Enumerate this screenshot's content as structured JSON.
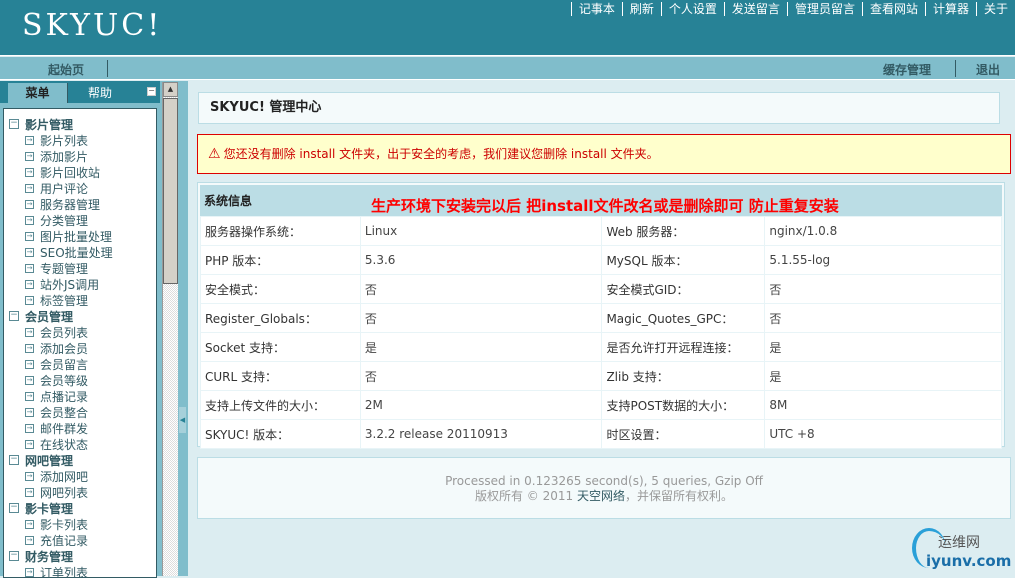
{
  "header": {
    "logo": "SKYUC!",
    "nav": [
      "记事本",
      "刷新",
      "个人设置",
      "发送留言",
      "管理员留言",
      "查看网站",
      "计算器",
      "关于"
    ]
  },
  "bar": {
    "home": "起始页",
    "cache": "缓存管理",
    "logout": "退出"
  },
  "sidebar": {
    "tabs": [
      "菜单",
      "帮助"
    ],
    "collapse": "−",
    "groups": [
      {
        "title": "影片管理",
        "items": [
          "影片列表",
          "添加影片",
          "影片回收站",
          "用户评论",
          "服务器管理",
          "分类管理",
          "图片批量处理",
          "SEO批量处理",
          "专题管理",
          "站外JS调用",
          "标签管理"
        ]
      },
      {
        "title": "会员管理",
        "items": [
          "会员列表",
          "添加会员",
          "会员留言",
          "会员等级",
          "点播记录",
          "会员整合",
          "邮件群发",
          "在线状态"
        ]
      },
      {
        "title": "网吧管理",
        "items": [
          "添加网吧",
          "网吧列表"
        ]
      },
      {
        "title": "影卡管理",
        "items": [
          "影卡列表",
          "充值记录"
        ]
      },
      {
        "title": "财务管理",
        "items": [
          "订单列表"
        ]
      }
    ]
  },
  "main": {
    "title": "SKYUC! 管理中心",
    "warning": "您还没有删除 install 文件夹，出于安全的考虑，我们建议您删除 install 文件夹。",
    "sysinfo": {
      "title": "系统信息",
      "annotation": "生产环境下安装完以后  把install文件改名或是删除即可  防止重复安装",
      "rows": [
        [
          "服务器操作系统：",
          "Linux",
          "Web 服务器：",
          "nginx/1.0.8"
        ],
        [
          "PHP 版本：",
          "5.3.6",
          "MySQL 版本：",
          "5.1.55-log"
        ],
        [
          "安全模式：",
          "否",
          "安全模式GID：",
          "否"
        ],
        [
          "Register_Globals：",
          "否",
          "Magic_Quotes_GPC：",
          "否"
        ],
        [
          "Socket 支持：",
          "是",
          "是否允许打开远程连接：",
          "是"
        ],
        [
          "CURL 支持：",
          "否",
          "Zlib 支持：",
          "是"
        ],
        [
          "支持上传文件的大小：",
          "2M",
          "支持POST数据的大小：",
          "8M"
        ],
        [
          "SKYUC! 版本：",
          "3.2.2 release 20110913",
          "时区设置：",
          "UTC +8"
        ]
      ]
    },
    "footer": {
      "processed": "Processed in 0.123265 second(s), 5 queries, Gzip Off",
      "copy_pre": "版权所有 © 2011 ",
      "company": "天空网络",
      "copy_post": "，并保留所有权利。"
    }
  },
  "watermark": {
    "cn": "运维网",
    "en": "iyunv.com"
  },
  "colors": {
    "header": "#278296",
    "bar": "#80bdcb",
    "warning": "#cc0000",
    "annotation": "#ff0000"
  }
}
